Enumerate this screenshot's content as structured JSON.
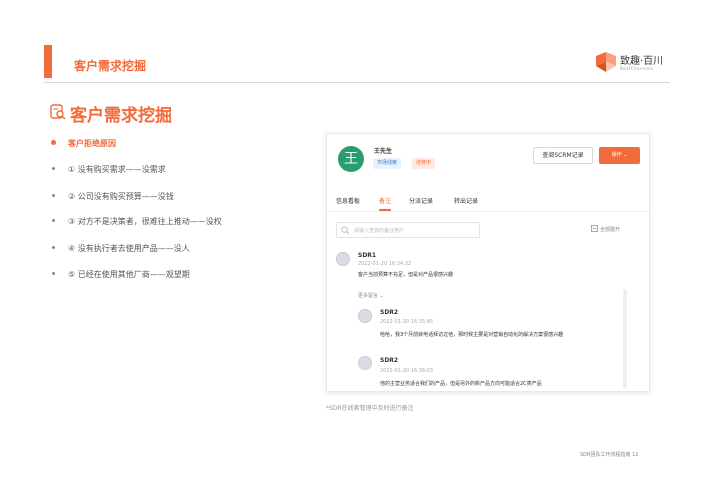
{
  "header": {
    "title": "客户需求挖掘",
    "logo_text": "致趣·百川",
    "logo_sub": "BestChannels"
  },
  "section": {
    "title": "客户需求挖掘"
  },
  "list": {
    "head": "客户拒绝原因",
    "items": [
      "① 没有购买需求——没需求",
      "② 公司没有购买预算——没钱",
      "③ 对方不是决策者，很难往上推动——没权",
      "④ 没有执行者去使用产品——没人",
      "⑤ 已经在使用其他厂商——观望期"
    ]
  },
  "crm": {
    "avatar_char": "王",
    "customer_name": "王先生",
    "tags": [
      "市场线索",
      "培育中"
    ],
    "scrm_button": "查阅SCRM记录",
    "op_button": "操作 ⌄",
    "tabs": [
      "信息看板",
      "备注",
      "分派记录",
      "转出记录"
    ],
    "search_placeholder": "请输入查找的备注用户",
    "expand_all": "全部展开",
    "more_notes": "更多留言 ⌄",
    "messages": [
      {
        "name": "SDR1",
        "time": "2022-01-20 16:34:32",
        "text": "客户当前预算不充足，但是对产品很感兴趣"
      },
      {
        "name": "SDR2",
        "time": "2022-01-20 16:35:45",
        "text": "哈哈，我3个月前就电话拜访过他，那时候主要是对营销自动化的解决方案很感兴趣"
      },
      {
        "name": "SDR2",
        "time": "2022-01-20 16:36:03",
        "text": "他的主营业务适合我们的产品，但是另外的新产品方向可能适合2C类产品"
      }
    ]
  },
  "caption": "*SDR在线索管理中及时进行备注",
  "footer": "SDR团队工作流程指南   12",
  "colors": {
    "accent": "#f26b3a",
    "avatar": "#2a9d6f"
  }
}
